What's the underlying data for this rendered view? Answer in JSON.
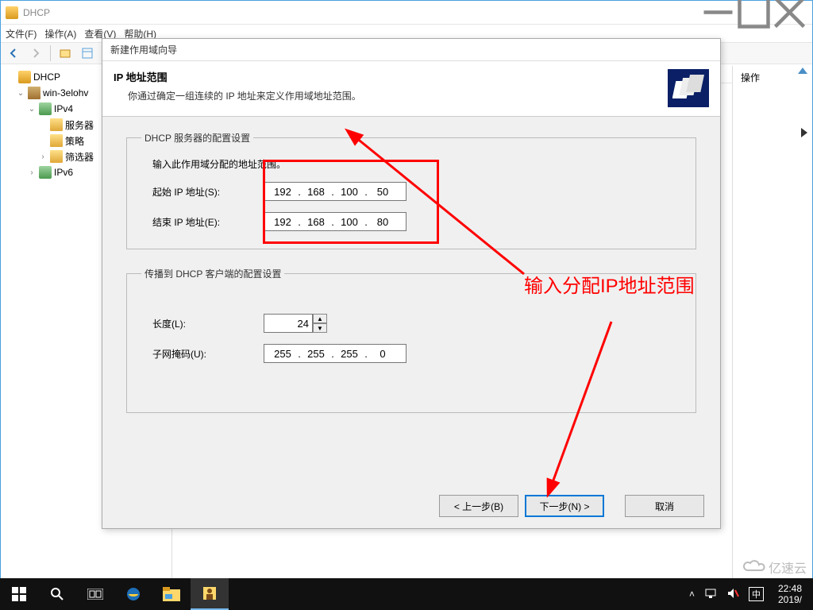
{
  "window": {
    "title": "DHCP"
  },
  "menu": {
    "file": "文件(F)",
    "action": "操作(A)",
    "view": "查看(V)",
    "help": "帮助(H)"
  },
  "tree": {
    "root": "DHCP",
    "server": "win-3elohv",
    "ipv4": "IPv4",
    "srvopt": "服务器",
    "policy": "策略",
    "filter": "筛选器",
    "ipv6": "IPv6"
  },
  "actions": {
    "header": "操作"
  },
  "wizard": {
    "title": "新建作用域向导",
    "heading": "IP 地址范围",
    "subheading": "你通过确定一组连续的 IP 地址来定义作用域地址范围。",
    "group1": "DHCP 服务器的配置设置",
    "intro": "输入此作用域分配的地址范围。",
    "start_label": "起始 IP 地址(S):",
    "end_label": "结束 IP 地址(E):",
    "start_ip": {
      "a": "192",
      "b": "168",
      "c": "100",
      "d": "50"
    },
    "end_ip": {
      "a": "192",
      "b": "168",
      "c": "100",
      "d": "80"
    },
    "group2": "传播到 DHCP 客户端的配置设置",
    "length_label": "长度(L):",
    "length_value": "24",
    "mask_label": "子网掩码(U):",
    "mask": {
      "a": "255",
      "b": "255",
      "c": "255",
      "d": "0"
    },
    "back": "< 上一步(B)",
    "next": "下一步(N) >",
    "cancel": "取消"
  },
  "annotation": {
    "text": "输入分配IP地址范围"
  },
  "taskbar": {
    "time": "22:48",
    "date": "2019/"
  },
  "watermark": {
    "text": "亿速云"
  }
}
